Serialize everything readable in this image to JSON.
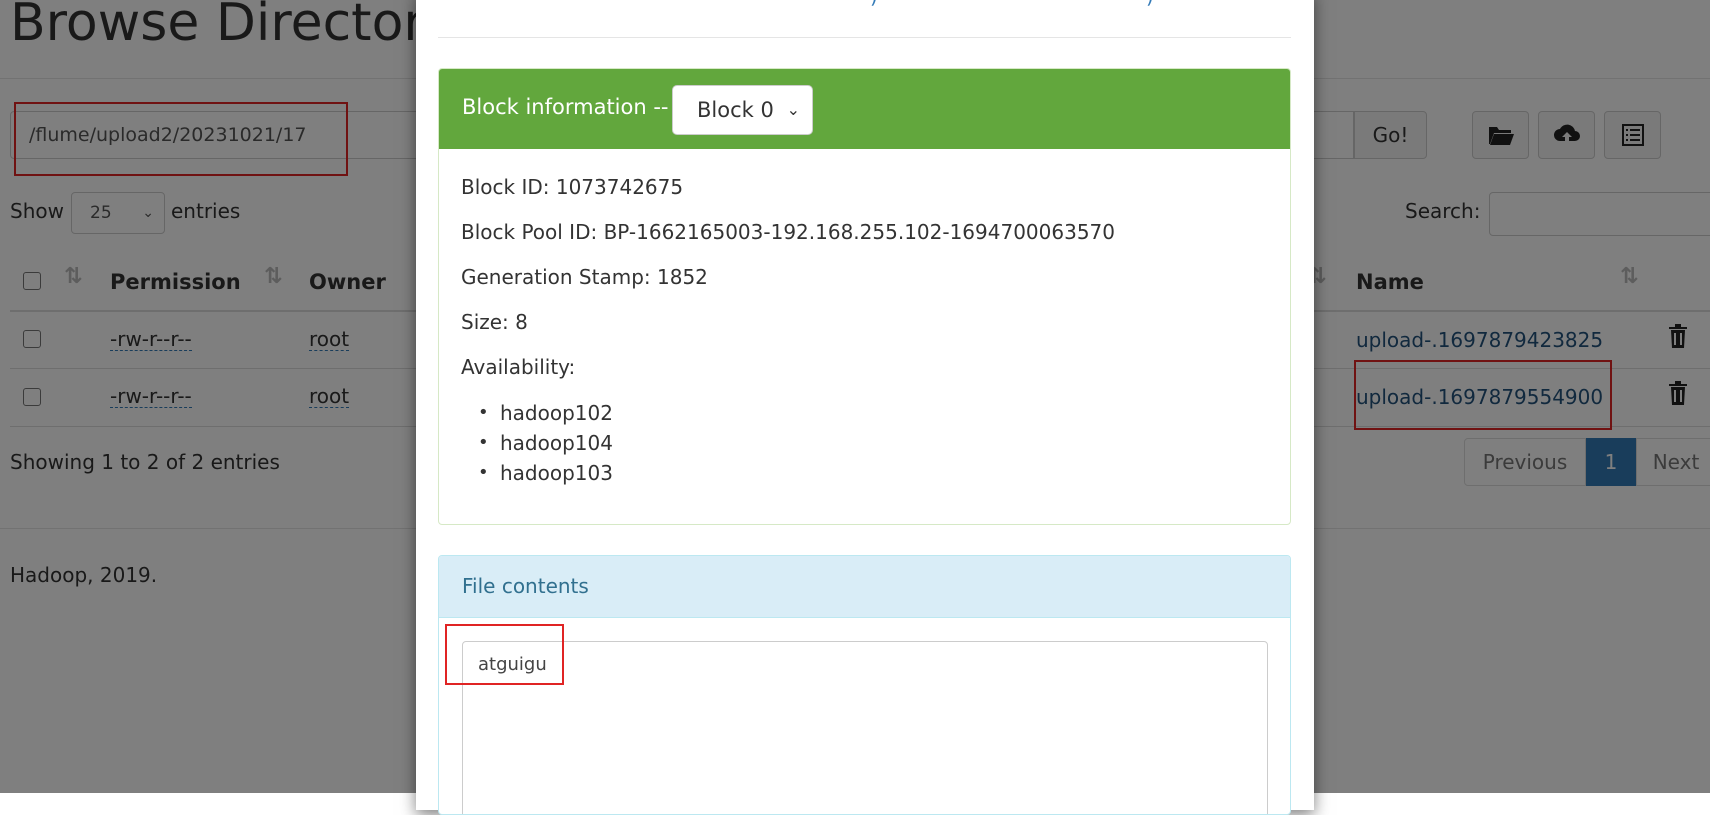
{
  "page": {
    "title": "Browse Directory",
    "path_value": "/flume/upload2/20231021/17",
    "go_label": "Go!",
    "show_label": "Show",
    "entries_label": "entries",
    "page_length": "25",
    "search_label": "Search:",
    "showing_text": "Showing 1 to 2 of 2 entries",
    "footer_text": "Hadoop, 2019.",
    "table": {
      "headers": {
        "permission": "Permission",
        "owner": "Owner",
        "name": "Name"
      },
      "rows": [
        {
          "permission": "-rw-r--r--",
          "owner": "root",
          "name": "upload-.1697879423825"
        },
        {
          "permission": "-rw-r--r--",
          "owner": "root",
          "name": "upload-.1697879554900"
        }
      ]
    },
    "pagination": {
      "previous": "Previous",
      "current": "1",
      "next": "Next"
    },
    "toolbar_icons": [
      "folder-open-icon",
      "cloud-upload-icon",
      "list-alt-icon"
    ]
  },
  "modal": {
    "block_panel": {
      "heading": "Block information --",
      "selected_block": "Block 0",
      "block_id": "Block ID: 1073742675",
      "block_pool_id": "Block Pool ID: BP-1662165003-192.168.255.102-1694700063570",
      "generation_stamp": "Generation Stamp: 1852",
      "size": "Size: 8",
      "availability_label": "Availability:",
      "availability": [
        "hadoop102",
        "hadoop104",
        "hadoop103"
      ]
    },
    "contents_panel": {
      "heading": "File contents",
      "text": "atguigu"
    }
  },
  "colors": {
    "block_heading_bg": "#62a73d",
    "contents_heading_bg": "#d9edf7",
    "link": "#23527c",
    "pager_active": "#337ab7",
    "highlight_box": "#e02424"
  }
}
